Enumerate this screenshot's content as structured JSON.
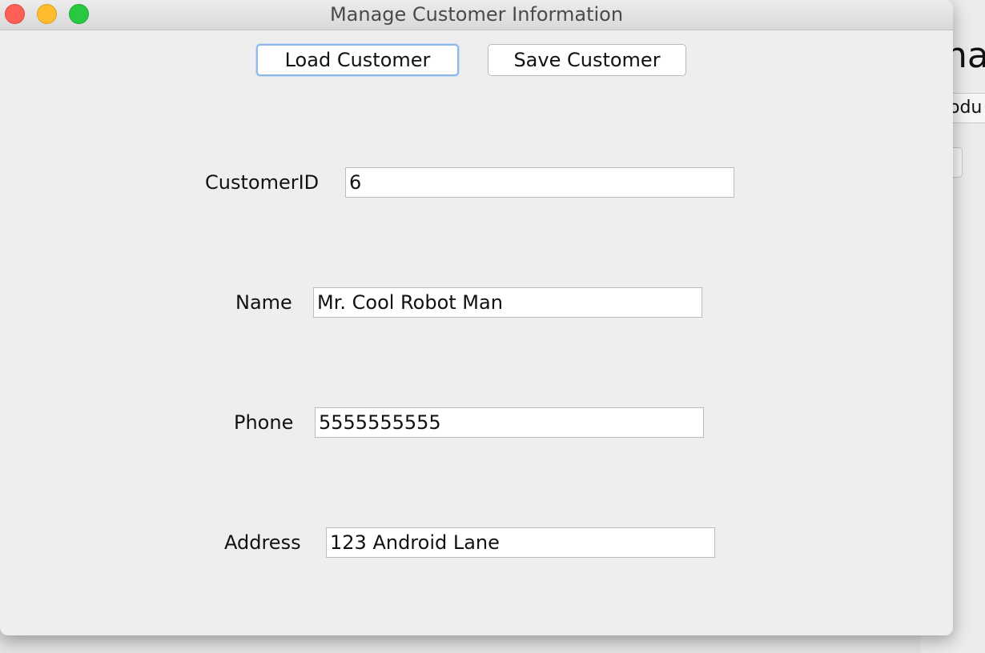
{
  "window": {
    "title": "Manage Customer Information"
  },
  "toolbar": {
    "load_label": "Load Customer",
    "save_label": "Save Customer"
  },
  "form": {
    "customer_id": {
      "label": "CustomerID",
      "value": "6"
    },
    "name": {
      "label": "Name",
      "value": "Mr. Cool Robot Man"
    },
    "phone": {
      "label": "Phone",
      "value": "5555555555"
    },
    "address": {
      "label": "Address",
      "value": "123 Android Lane"
    }
  },
  "background_window": {
    "title_fragment": "na",
    "tab_fragment": "odu"
  },
  "colors": {
    "close": "#fe5f57",
    "minimize": "#febc2e",
    "maximize": "#28c840",
    "focus_ring": "#8fb7e8"
  },
  "icons": [
    "close-icon",
    "minimize-icon",
    "maximize-icon"
  ]
}
